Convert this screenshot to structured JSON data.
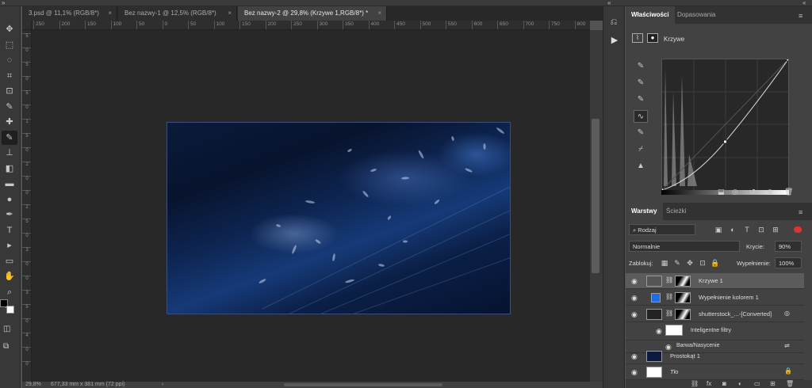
{
  "document_tabs": [
    {
      "label": "3.psd @ 11,1% (RGB/8*)",
      "active": false
    },
    {
      "label": "Bez nazwy-1 @ 12,5% (RGB/8*)",
      "active": false
    },
    {
      "label": "Bez nazwy-2 @ 29,8% (Krzywe 1,RGB/8*) *",
      "active": true
    }
  ],
  "tab_close_glyph": "×",
  "ruler": {
    "h_ticks": [
      "250",
      "200",
      "150",
      "100",
      "50",
      "0",
      "50",
      "100",
      "150",
      "200",
      "250",
      "300",
      "350",
      "400",
      "450",
      "500",
      "550",
      "600",
      "650",
      "700",
      "750",
      "800"
    ],
    "v_ticks": [
      "5",
      "0",
      "5",
      "0",
      "5",
      "0",
      "1",
      "5",
      "0",
      "2",
      "0",
      "0",
      "2",
      "5",
      "0",
      "3",
      "0",
      "0",
      "3",
      "5",
      "0",
      "4",
      "0",
      "0"
    ]
  },
  "status": {
    "zoom": "29,8%",
    "doc_size": "677,33 mm x 381 mm (72 ppi)",
    "arrow": "›"
  },
  "tools": [
    "move-tool",
    "marquee-tool",
    "lasso-tool",
    "crop-tool",
    "frame-tool",
    "eyedropper-tool",
    "healing-tool",
    "brush-tool",
    "stamp-tool",
    "eraser-tool",
    "gradient-tool",
    "blur-tool",
    "pen-tool",
    "type-tool",
    "path-select-tool",
    "shape-tool",
    "hand-tool",
    "zoom-tool",
    "more-tools"
  ],
  "tool_glyphs": [
    "✥",
    "⬚",
    "◌",
    "⌗",
    "⊡",
    "✎",
    "✚",
    "✎",
    "⊥",
    "◧",
    "▬",
    "●",
    "✒",
    "T",
    "▸",
    "▭",
    "✋",
    "⌕",
    "•••"
  ],
  "properties": {
    "tabs": [
      "Właściwości",
      "Dopasowania"
    ],
    "adjustment_name": "Krzywe",
    "tool_glyphs": [
      "✎",
      "✎",
      "✎",
      "∿",
      "✎",
      "⌿",
      "▲"
    ]
  },
  "layers_panel": {
    "tabs": [
      "Warstwy",
      "Ścieżki"
    ],
    "filter_kind": "Rodzaj",
    "blend_mode": "Normalnie",
    "opacity_label": "Krycie:",
    "opacity_value": "90%",
    "lock_label": "Zablokuj:",
    "fill_label": "Wypełnienie:",
    "fill_value": "100%",
    "layers": [
      {
        "name": "Krzywe 1",
        "selected": true
      },
      {
        "name": "Wypełnienie kolorem 1",
        "selected": false
      },
      {
        "name": "shutterstock_...-[Converted]",
        "selected": false
      },
      {
        "name": "Inteligentne filtry",
        "selected": false
      },
      {
        "name": "Barwa/Nasycenie",
        "selected": false
      },
      {
        "name": "Prostokąt 1",
        "selected": false
      },
      {
        "name": "Tło",
        "selected": false
      }
    ],
    "footer_icons": [
      "link-icon",
      "fx-icon",
      "mask-icon",
      "adjustment-icon",
      "group-icon",
      "new-layer-icon",
      "trash-icon"
    ],
    "footer_glyphs": [
      "⛓",
      "fx",
      "◙",
      "◐",
      "▭",
      "⊞",
      "🗑"
    ]
  },
  "colors": {
    "foreground": "#000000",
    "background": "#ffffff",
    "fill_layer_color": "#1e6fe6",
    "panel_bg": "#424242",
    "canvas_bg": "#282828"
  },
  "curve_points": [
    [
      0,
      0
    ],
    [
      0.5,
      0.37
    ],
    [
      1,
      1
    ]
  ]
}
